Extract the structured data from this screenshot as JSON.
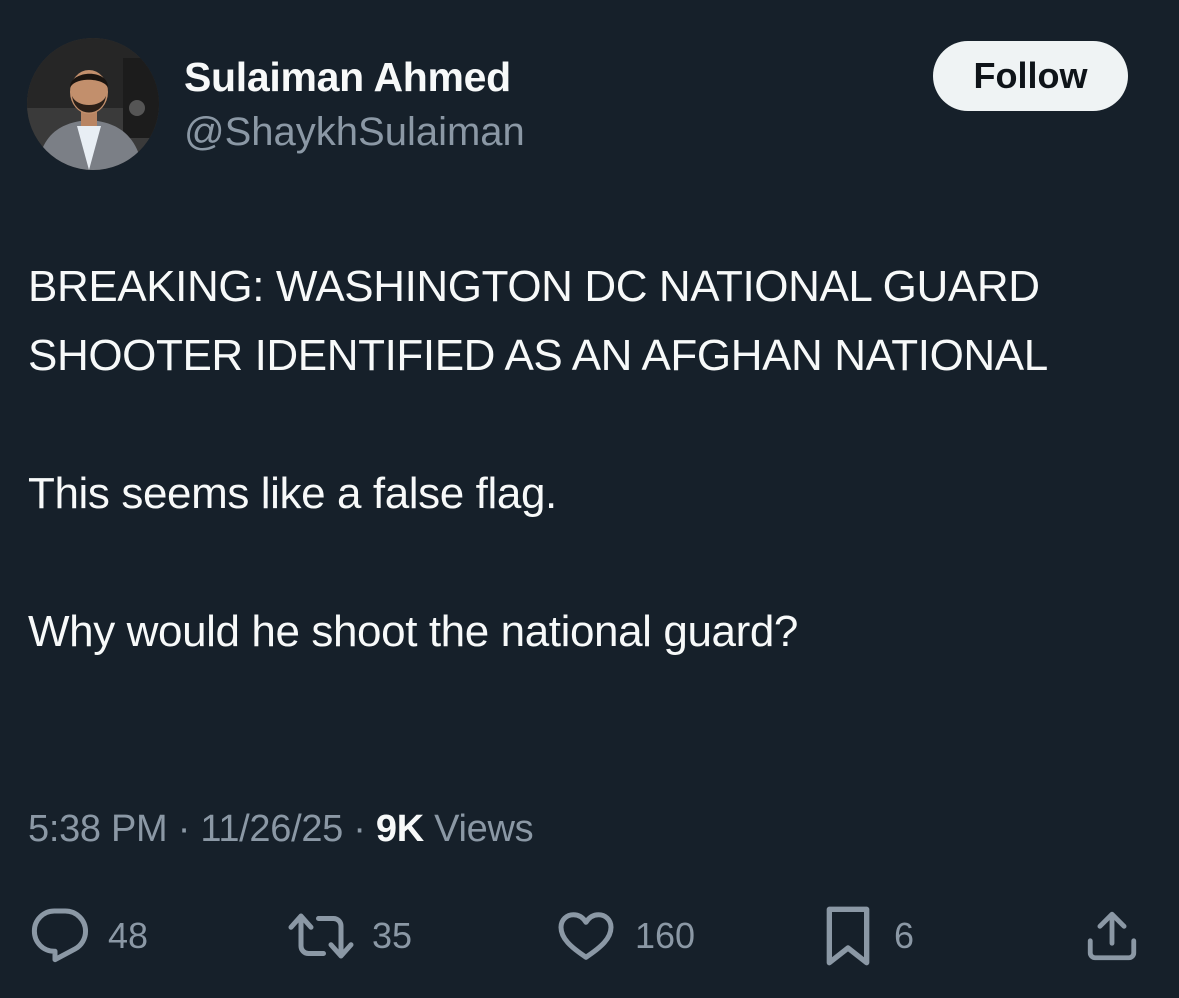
{
  "author": {
    "name": "Sulaiman Ahmed",
    "handle": "@ShaykhSulaiman"
  },
  "follow_label": "Follow",
  "tweet": {
    "lines": [
      "BREAKING: WASHINGTON DC NATIONAL GUARD SHOOTER IDENTIFIED AS AN AFGHAN NATIONAL",
      "This seems like a false flag.",
      "Why would he shoot the national guard?"
    ]
  },
  "meta": {
    "time": "5:38 PM",
    "separator": "·",
    "date": "11/26/25",
    "views_count": "9K",
    "views_label": "Views"
  },
  "actions": {
    "replies": "48",
    "reposts": "35",
    "likes": "160",
    "bookmarks": "6"
  },
  "icons": {
    "reply": "reply-icon",
    "repost": "repost-icon",
    "like": "heart-icon",
    "bookmark": "bookmark-icon",
    "share": "share-icon"
  },
  "colors": {
    "background": "#16202a",
    "text": "#f7f9f9",
    "secondary": "#8b98a5",
    "follow_bg": "#eff3f4"
  }
}
